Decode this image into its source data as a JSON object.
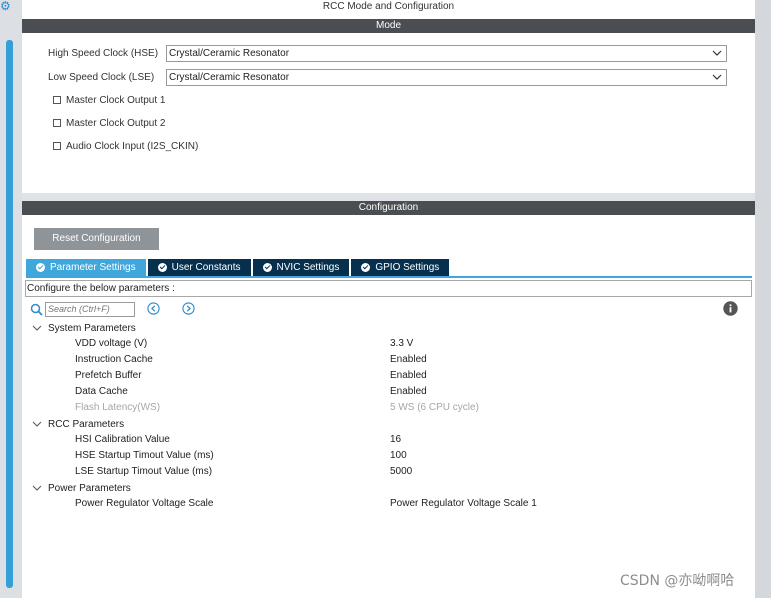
{
  "title": "RCC Mode and Configuration",
  "mode": {
    "header": "Mode",
    "hse": {
      "label": "High Speed Clock (HSE)",
      "value": "Crystal/Ceramic Resonator"
    },
    "lse": {
      "label": "Low Speed Clock (LSE)",
      "value": "Crystal/Ceramic Resonator"
    },
    "checkboxes": [
      {
        "label": "Master Clock Output 1",
        "checked": false
      },
      {
        "label": "Master Clock Output 2",
        "checked": false
      },
      {
        "label": "Audio Clock Input (I2S_CKIN)",
        "checked": false
      }
    ]
  },
  "configuration": {
    "header": "Configuration",
    "reset_label": "Reset Configuration",
    "tabs": [
      {
        "label": "Parameter Settings",
        "active": true
      },
      {
        "label": "User Constants",
        "active": false
      },
      {
        "label": "NVIC Settings",
        "active": false
      },
      {
        "label": "GPIO Settings",
        "active": false
      }
    ],
    "note": "Configure the below parameters :",
    "search_placeholder": "Search (Ctrl+F)",
    "groups": [
      {
        "name": "System Parameters",
        "params": [
          {
            "name": "VDD voltage (V)",
            "value": "3.3 V",
            "disabled": false
          },
          {
            "name": "Instruction Cache",
            "value": "Enabled",
            "disabled": false
          },
          {
            "name": "Prefetch Buffer",
            "value": "Enabled",
            "disabled": false
          },
          {
            "name": "Data Cache",
            "value": "Enabled",
            "disabled": false
          },
          {
            "name": "Flash Latency(WS)",
            "value": "5 WS (6 CPU cycle)",
            "disabled": true
          }
        ]
      },
      {
        "name": "RCC Parameters",
        "params": [
          {
            "name": "HSI Calibration Value",
            "value": "16",
            "disabled": false
          },
          {
            "name": "HSE Startup Timout Value (ms)",
            "value": "100",
            "disabled": false
          },
          {
            "name": "LSE Startup Timout Value (ms)",
            "value": "5000",
            "disabled": false
          }
        ]
      },
      {
        "name": "Power Parameters",
        "params": [
          {
            "name": "Power Regulator Voltage Scale",
            "value": "Power Regulator Voltage Scale 1",
            "disabled": false
          }
        ]
      }
    ]
  },
  "watermark": "CSDN @亦呦啊哈",
  "colors": {
    "accent": "#3fa7dc",
    "tab_dark": "#07304f",
    "section_bar": "#4a4e52",
    "button": "#8f9499"
  }
}
